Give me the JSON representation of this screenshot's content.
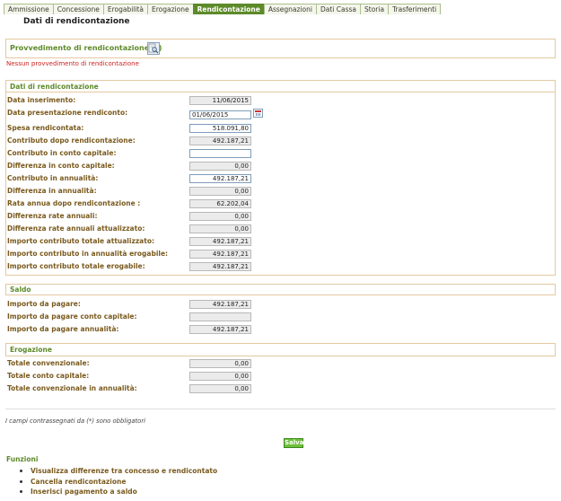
{
  "tabs": [
    {
      "label": "Ammissione",
      "active": false
    },
    {
      "label": "Concessione",
      "active": false
    },
    {
      "label": "Erogabilità",
      "active": false
    },
    {
      "label": "Erogazione",
      "active": false
    },
    {
      "label": "Rendicontazione",
      "active": true
    },
    {
      "label": "Assegnazioni",
      "active": false
    },
    {
      "label": "Dati Cassa",
      "active": false
    },
    {
      "label": "Storia",
      "active": false
    },
    {
      "label": "Trasferimenti",
      "active": false
    }
  ],
  "page_title": "Dati di rendicontazione",
  "provvedimento": {
    "title": "Provvedimento di rendicontazione (*)",
    "empty_message": "Nessun provvedimento di rendicontazione"
  },
  "dati": {
    "title": "Dati di rendicontazione",
    "rows": [
      {
        "label": "Data inserimento:",
        "value": "11/06/2015"
      },
      {
        "label": "Data presentazione rendiconto:",
        "value": "01/06/2015"
      },
      {
        "label": "Spesa rendicontata:",
        "value": "518.091,80"
      },
      {
        "label": "Contributo dopo rendicontazione:",
        "value": "492.187,21"
      },
      {
        "label": "Contributo in conto capitale:",
        "value": ""
      },
      {
        "label": "Differenza in conto capitale:",
        "value": "0,00"
      },
      {
        "label": "Contributo in annualità:",
        "value": "492.187,21"
      },
      {
        "label": "Differenza in annualità:",
        "value": "0,00"
      },
      {
        "label": "Rata annua dopo rendicontazione :",
        "value": "62.202,04"
      },
      {
        "label": "Differenza rate annuali:",
        "value": "0,00"
      },
      {
        "label": "Differenza rate annuali attualizzato:",
        "value": "0,00"
      },
      {
        "label": "Importo contributo totale attualizzato:",
        "value": "492.187,21"
      },
      {
        "label": "Importo contributo in annualità erogabile:",
        "value": "492.187,21"
      },
      {
        "label": "Importo contributo totale erogabile:",
        "value": "492.187,21"
      }
    ]
  },
  "saldo": {
    "title": "Saldo",
    "rows": [
      {
        "label": "Importo da pagare:",
        "value": "492.187,21"
      },
      {
        "label": "Importo da pagare conto capitale:",
        "value": ""
      },
      {
        "label": "Importo da pagare annualità:",
        "value": "492.187,21"
      }
    ]
  },
  "erogazione": {
    "title": "Erogazione",
    "rows": [
      {
        "label": "Totale convenzionale:",
        "value": "0,00"
      },
      {
        "label": "Totale conto capitale:",
        "value": "0,00"
      },
      {
        "label": "Totale convenzionale in annualità:",
        "value": "0,00"
      }
    ]
  },
  "note": "I campi contrassegnati da (*) sono obbligatori",
  "save_label": "Salva",
  "funzioni": {
    "title": "Funzioni",
    "items": [
      "Visualizza differenze tra concesso e rendicontato",
      "Cancella rendicontazione",
      "Inserisci pagamento a saldo"
    ]
  }
}
